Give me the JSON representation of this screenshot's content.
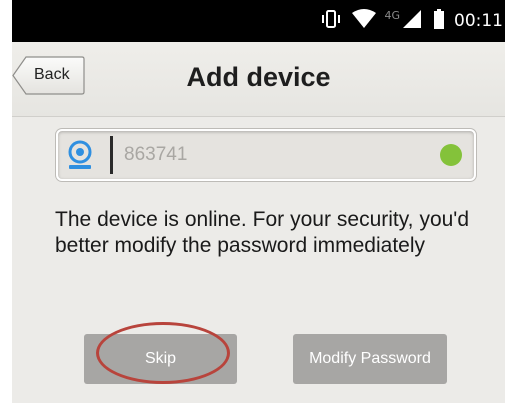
{
  "status_bar": {
    "network": "4G",
    "time": "00:11",
    "icons": [
      "vibrate-icon",
      "wifi-icon",
      "signal-icon",
      "battery-icon"
    ]
  },
  "header": {
    "back_label": "Back",
    "title": "Add device"
  },
  "device_field": {
    "icon": "camera-icon",
    "value": "863741",
    "status": "online",
    "status_color": "#84c23a"
  },
  "message": "The device is online. For your security, you'd better modify the password immediately",
  "buttons": {
    "skip_label": "Skip",
    "modify_label": "Modify Password"
  },
  "annotation": {
    "highlight_color": "#b8443c"
  }
}
